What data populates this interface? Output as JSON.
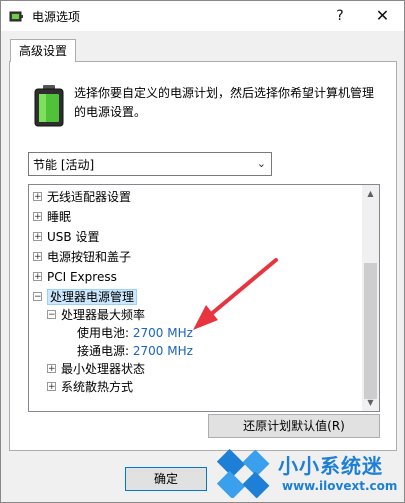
{
  "window": {
    "title": "电源选项",
    "help_label": "?",
    "close_label": "✕"
  },
  "tab": {
    "label": "高级设置"
  },
  "description": "选择你要自定义的电源计划，然后选择你希望计算机管理的电源设置。",
  "plan_combo": {
    "selected": "节能 [活动]",
    "arrow": "⌄"
  },
  "tree": {
    "items": [
      {
        "expander": "+",
        "label": "无线适配器设置"
      },
      {
        "expander": "+",
        "label": "睡眠"
      },
      {
        "expander": "+",
        "label": "USB 设置"
      },
      {
        "expander": "+",
        "label": "电源按钮和盖子"
      },
      {
        "expander": "+",
        "label": "PCI Express"
      },
      {
        "expander": "−",
        "label": "处理器电源管理"
      },
      {
        "expander": "−",
        "label": "处理器最大频率"
      },
      {
        "label": "使用电池:",
        "value": "2700 MHz"
      },
      {
        "label": "接通电源:",
        "value": "2700 MHz"
      },
      {
        "expander": "+",
        "label": "最小处理器状态"
      },
      {
        "expander": "+",
        "label": "系统散热方式"
      }
    ],
    "scroll_up": "▲",
    "scroll_down": "▼"
  },
  "restore_button": "还原计划默认值(R)",
  "ok_button": "确定",
  "watermark": {
    "brand": "小小系统迷",
    "url": "www.ilovext.com"
  },
  "colors": {
    "accent": "#1d7fd6",
    "selection": "#cce8ff",
    "arrow": "#e8343f",
    "value_text": "#1a62c7"
  }
}
